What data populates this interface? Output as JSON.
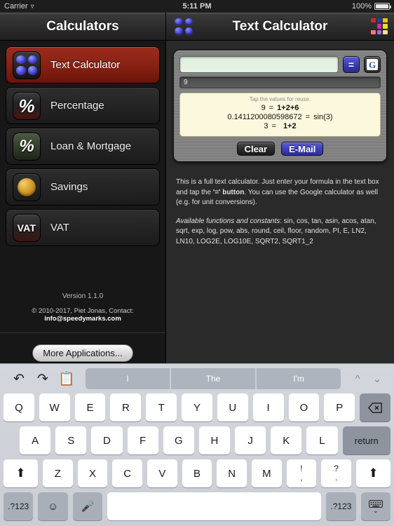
{
  "statusbar": {
    "carrier": "Carrier",
    "wifi_icon": "wifi-icon",
    "time": "5:11 PM",
    "battery_pct": "100%"
  },
  "navbar": {
    "left_title": "Calculators",
    "right_title": "Text Calculator",
    "left_icon": "four-dots-icon",
    "right_icon": "color-grid-icon",
    "grid_colors": [
      "#e02020",
      "#1f3fbf",
      "#f2c014",
      "#2f2f2f",
      "#e020c0",
      "#e8e020",
      "#f07878",
      "#9a6fd8",
      "#f2e28a"
    ]
  },
  "sidebar": {
    "items": [
      {
        "label": "Text Calculator",
        "icon": "text-calculator-icon",
        "selected": true
      },
      {
        "label": "Percentage",
        "icon": "percent-icon",
        "selected": false
      },
      {
        "label": "Loan & Mortgage",
        "icon": "loan-percent-icon",
        "selected": false
      },
      {
        "label": "Savings",
        "icon": "coin-icon",
        "selected": false
      },
      {
        "label": "VAT",
        "icon": "vat-icon",
        "selected": false
      }
    ],
    "footer": {
      "version": "Version 1.1.0",
      "copyright_prefix": "© 2010-2017, Piet Jonas, Contact: ",
      "contact_email": "info@speedymarks.com",
      "more_apps_button": "More Applications..."
    }
  },
  "calculator": {
    "input_value": "",
    "input_placeholder": "",
    "equals_button": "=",
    "google_button": "G",
    "echo_value": "9",
    "hint": "Tap the values for reuse.",
    "results": [
      {
        "lhs": "9",
        "eq": "=",
        "rhs": "1+2+6"
      },
      {
        "lhs": "0.1411200080598672",
        "eq": "=",
        "rhs": "sin(3)"
      },
      {
        "lhs": "3",
        "eq": "=",
        "rhs": "1+2"
      }
    ],
    "clear_button": "Clear",
    "email_button": "E-Mail"
  },
  "description": {
    "p1_a": "This is a full text calculator. Just enter your formula in the text box and tap the ",
    "p1_b": "'='",
    "p1_c": " button",
    "p1_d": ". You can use the Google calculator as well (e.g. for unit conversions).",
    "p2_title": "Available functions and constants",
    "p2_body": ": sin, cos, tan, asin, acos, atan, sqrt, exp, log, pow, abs, round, ceil, floor, random, PI, E, LN2, LN10, LOG2E, LOG10E, SQRT2, SQRT1_2"
  },
  "keyboard": {
    "undo_icon": "undo-icon",
    "redo_icon": "redo-icon",
    "paste_icon": "paste-icon",
    "suggestions": [
      "I",
      "The",
      "I'm"
    ],
    "up_icon": "chevron-up-icon",
    "down_icon": "chevron-down-icon",
    "row1": [
      "Q",
      "W",
      "E",
      "R",
      "T",
      "Y",
      "U",
      "I",
      "O",
      "P"
    ],
    "backspace": "backspace-icon",
    "row2": [
      "A",
      "S",
      "D",
      "F",
      "G",
      "H",
      "J",
      "K",
      "L"
    ],
    "return_key": "return",
    "shift_key": "shift-icon",
    "row3": [
      "Z",
      "X",
      "C",
      "V",
      "B",
      "N",
      "M"
    ],
    "punct1_top": "!",
    "punct1_bot": ",",
    "punct2_top": "?",
    "punct2_bot": ".",
    "numbers_key_left": ".?123",
    "emoji_key": "emoji-icon",
    "mic_key": "microphone-icon",
    "space_key": "",
    "numbers_key_right": ".?123",
    "dismiss_key": "hide-keyboard-icon"
  }
}
